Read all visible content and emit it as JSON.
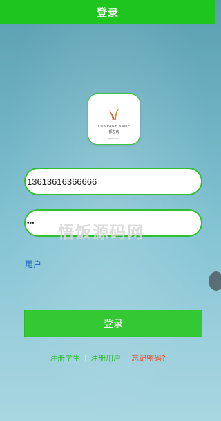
{
  "header": {
    "title": "登录"
  },
  "logo": {
    "company_name": "COMPANY NAME",
    "chinese_name": "都左病",
    "url_text": "logoip.com"
  },
  "form": {
    "phone_value": "13613616366666",
    "password_masked": "•••",
    "role_label": "用户",
    "login_label": "登录"
  },
  "watermark": "悟饭源码网",
  "links": {
    "register_student": "注册学生",
    "register_user": "注册用户",
    "forgot_password": "忘记密码?"
  },
  "colors": {
    "primary_green": "#1fc51f",
    "button_green": "#35c835",
    "link_red": "#e8502a",
    "role_blue": "#1a5fc0"
  }
}
